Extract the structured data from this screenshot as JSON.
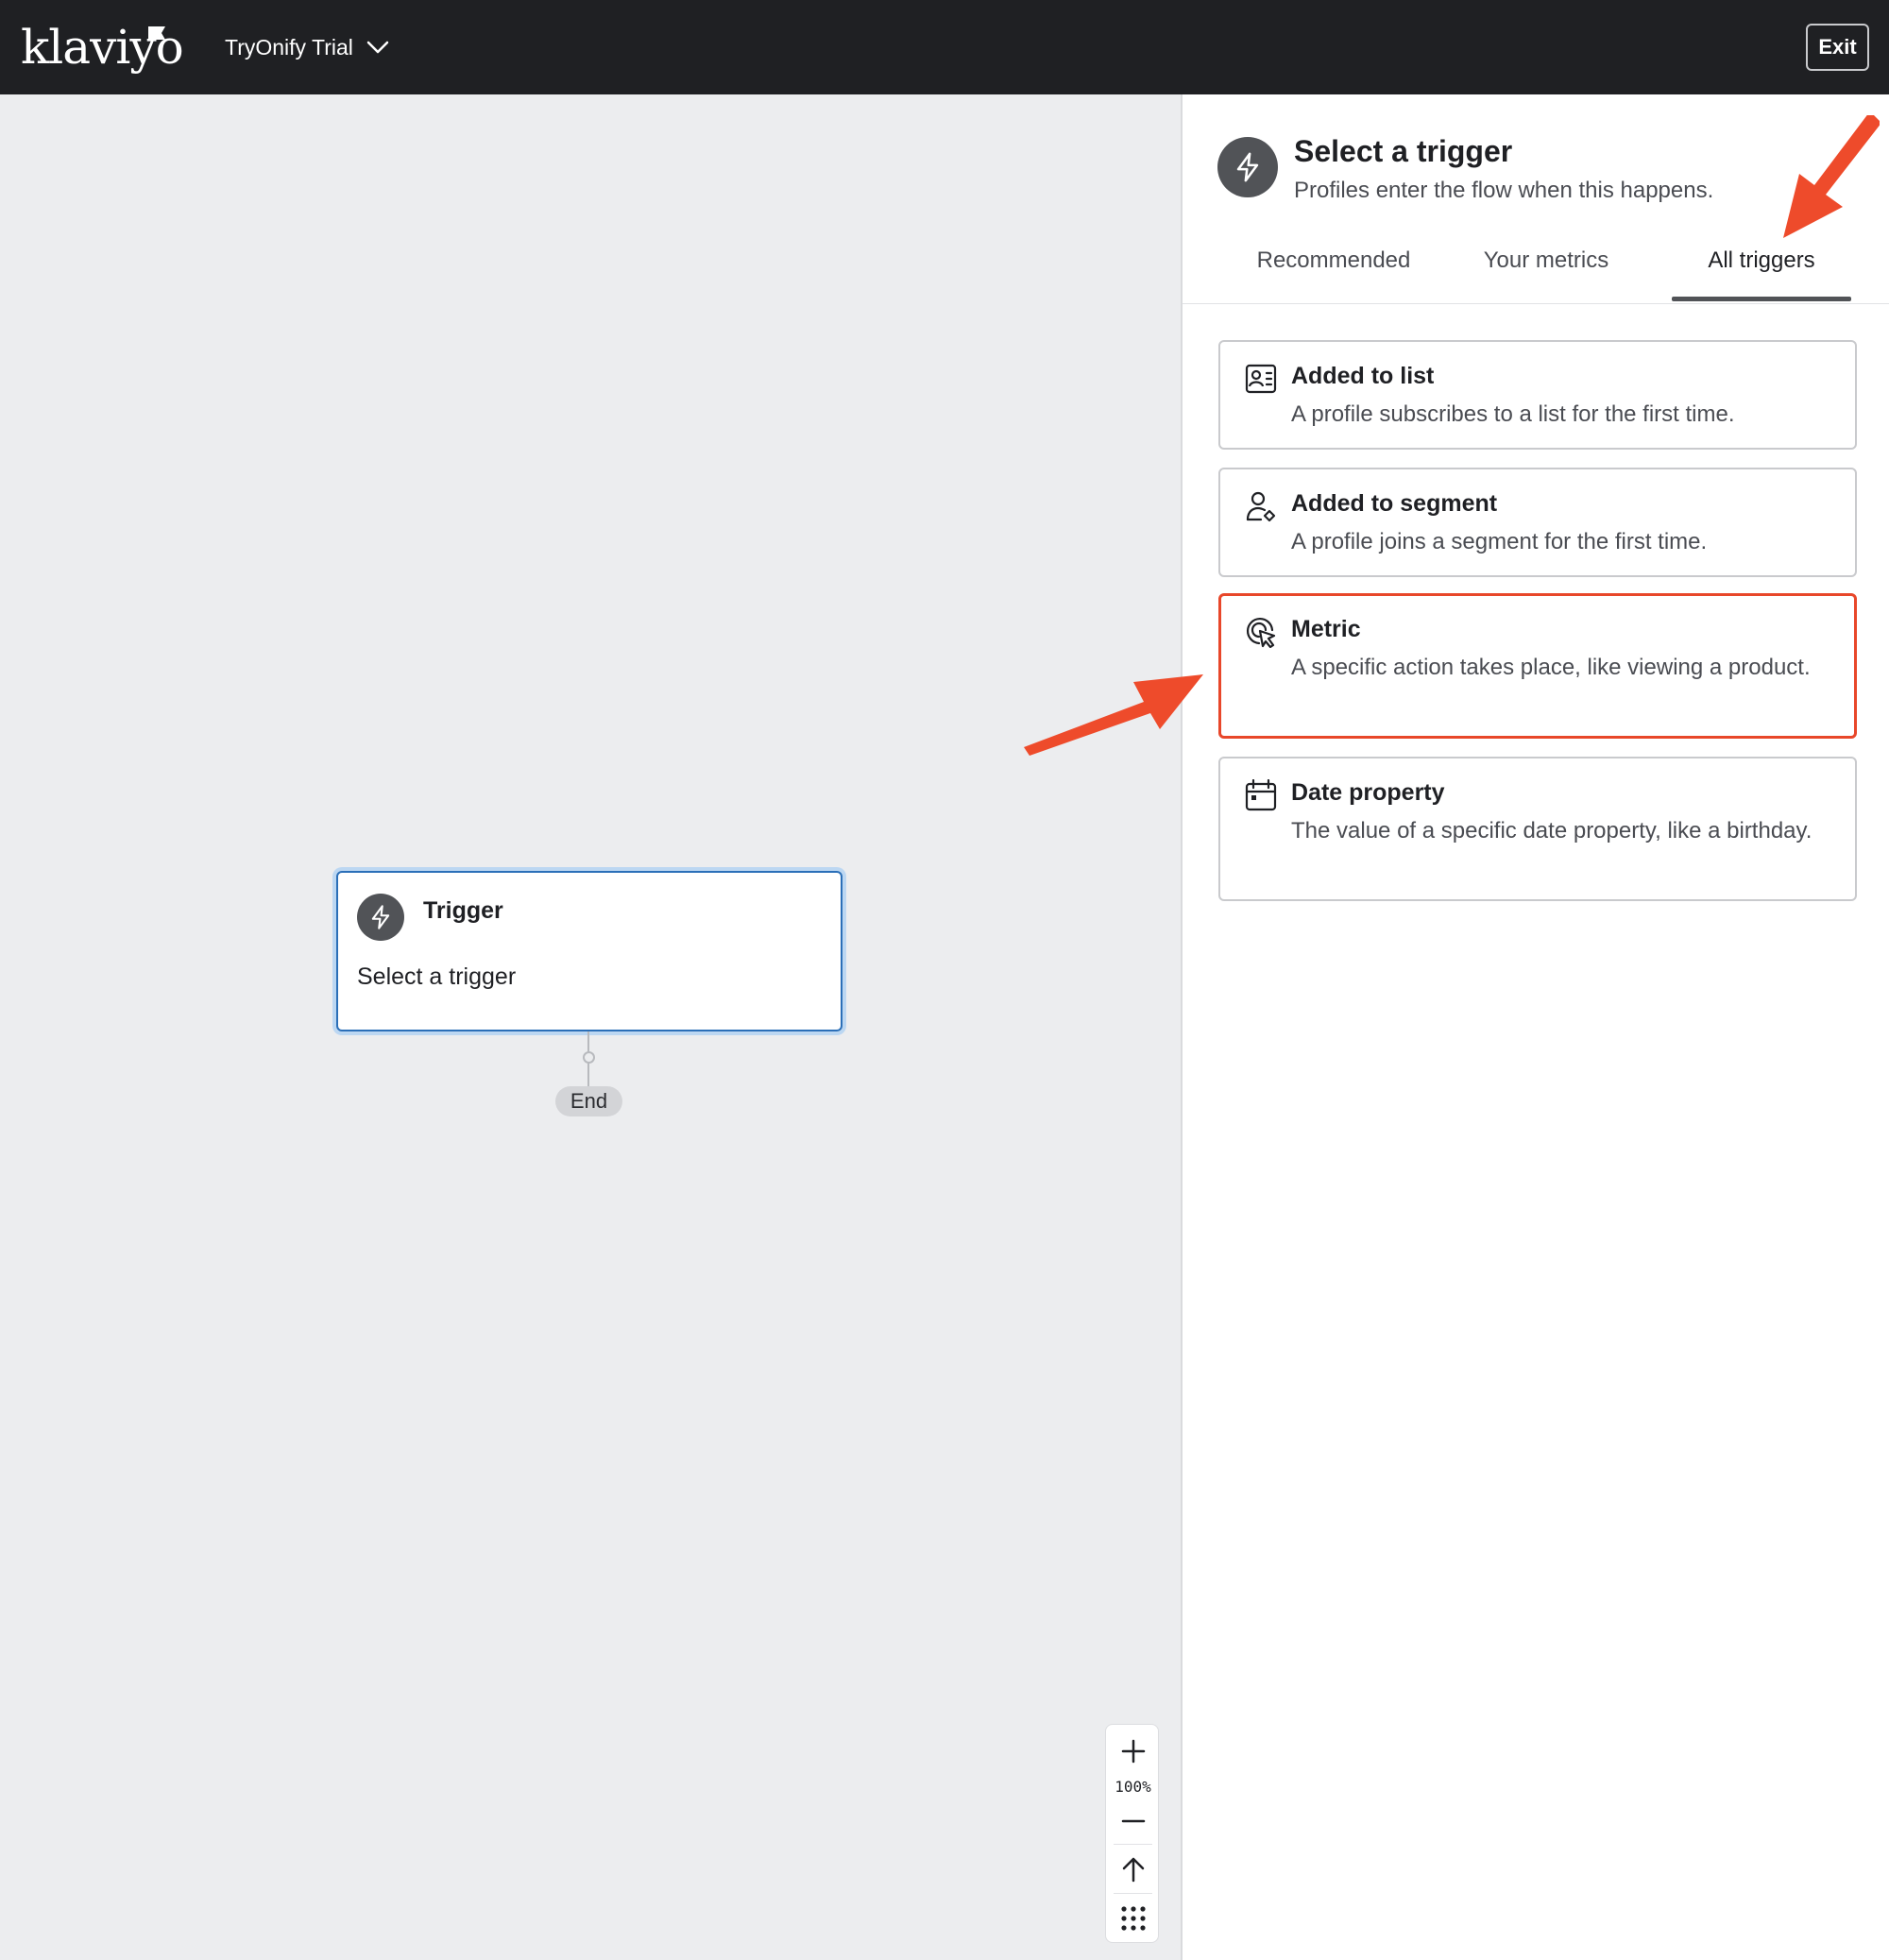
{
  "topbar": {
    "logo_text": "klaviyo",
    "account_name": "TryOnify Trial",
    "exit_label": "Exit"
  },
  "canvas": {
    "trigger_node": {
      "title": "Trigger",
      "subtitle": "Select a trigger",
      "icon": "lightning-icon"
    },
    "end_label": "End",
    "zoom_level": "100%"
  },
  "panel": {
    "title": "Select a trigger",
    "subtitle": "Profiles enter the flow when this happens.",
    "tabs": [
      {
        "label": "Recommended",
        "active": false
      },
      {
        "label": "Your metrics",
        "active": false
      },
      {
        "label": "All triggers",
        "active": true
      }
    ],
    "triggers": [
      {
        "title": "Added to list",
        "description": "A profile subscribes to a list for the first time.",
        "icon": "list-contact-icon"
      },
      {
        "title": "Added to segment",
        "description": "A profile joins a segment for the first time.",
        "icon": "user-segment-icon"
      },
      {
        "title": "Metric",
        "description": "A specific action takes place, like viewing a product.",
        "icon": "cursor-click-icon",
        "highlighted": true
      },
      {
        "title": "Date property",
        "description": "The value of a specific date property, like a birthday.",
        "icon": "calendar-icon"
      }
    ]
  },
  "colors": {
    "topbar_bg": "#1f2023",
    "canvas_bg": "#ecedef",
    "highlight": "#e8472a",
    "selected_node_border": "#2b6fb8"
  }
}
